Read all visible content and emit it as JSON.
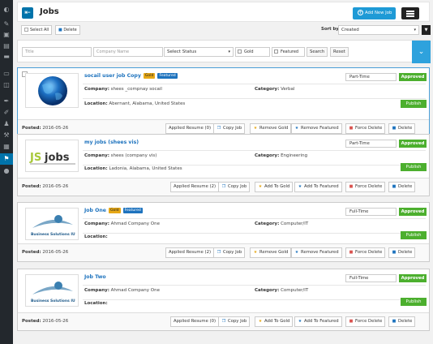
{
  "header": {
    "title": "Jobs",
    "add_label": "Add New Job"
  },
  "toolbar": {
    "select_all": "Select All",
    "delete": "Delete",
    "sort_label": "Sort by:",
    "sort_value": "Created"
  },
  "filters": {
    "title_placeholder": "Title",
    "company_placeholder": "Company Name",
    "status_value": "Select Status",
    "gold": "Gold",
    "featured": "Featured",
    "search": "Search",
    "reset": "Reset"
  },
  "labels": {
    "company": "Company:",
    "category": "Category:",
    "location": "Location:",
    "posted": "Posted:",
    "publish": "Publish",
    "approved": "Approved",
    "gold_badge": "Gold",
    "featured_badge": "Featured"
  },
  "jobs": [
    {
      "title": "socail user job Copy",
      "company": "shees _compnay socail",
      "category": "Verbal",
      "location": "Abernant, Alabama, United States",
      "type": "Part-Time",
      "posted": "2016-05-26",
      "actions": [
        "Applied Resume (0)",
        "Copy Job",
        "Remove Gold",
        "Remove Featured",
        "Force Delete",
        "Delete"
      ]
    },
    {
      "title": "my jobs (shees vis)",
      "company": "shees (company vis)",
      "category": "Engineering",
      "location": "Ladonia, Alabama, United States",
      "type": "Part-Time",
      "posted": "2016-05-26",
      "actions": [
        "Applied Resume (2)",
        "Copy Job",
        "Add To Gold",
        "Add To Featured",
        "Force Delete",
        "Delete"
      ]
    },
    {
      "title": "Job One",
      "company": "Ahmad Company One",
      "category": "Computer/IT",
      "location": "",
      "type": "Full-Time",
      "posted": "2016-05-26",
      "actions": [
        "Applied Resume (2)",
        "Copy Job",
        "Remove Gold",
        "Remove Featured",
        "Force Delete",
        "Delete"
      ]
    },
    {
      "title": "Job Two",
      "company": "Ahmad Company One",
      "category": "Computer/IT",
      "location": "",
      "type": "Full-Time",
      "posted": "2016-05-26",
      "actions": [
        "Applied Resume (0)",
        "Copy Job",
        "Add To Gold",
        "Add To Featured",
        "Force Delete",
        "Delete"
      ]
    }
  ],
  "logos": {
    "jsjobs_text": "jobs",
    "jsjobs_prefix": "JS",
    "business_text": "Business Solutions IU"
  },
  "colors": {
    "accent": "#1e9ad6",
    "approved": "#4caf2e",
    "sidebar": "#23282d"
  }
}
